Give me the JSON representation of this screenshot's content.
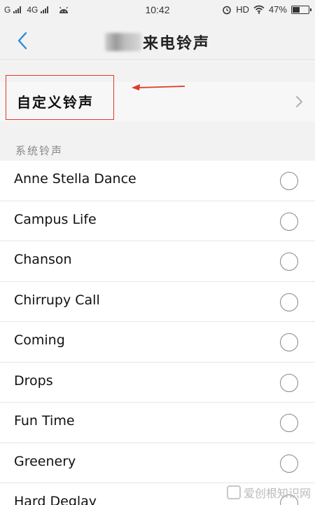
{
  "status_bar": {
    "sim1_label": "G",
    "sim2_label": "4G",
    "time": "10:42",
    "network": "HD",
    "battery": "47%",
    "battery_level": 0.47
  },
  "header": {
    "title_suffix": "来电铃声"
  },
  "custom_ringtone": {
    "label": "自定义铃声"
  },
  "section": {
    "label": "系统铃声"
  },
  "ringtones": [
    "Anne Stella Dance",
    "Campus Life",
    "Chanson",
    "Chirrupy Call",
    "Coming",
    "Drops",
    "Fun Time",
    "Greenery",
    "Hard Deglay"
  ],
  "watermark": {
    "text": "爱创根知识网"
  },
  "colors": {
    "accent": "#2a8bd8",
    "annotation": "#e0392b"
  }
}
